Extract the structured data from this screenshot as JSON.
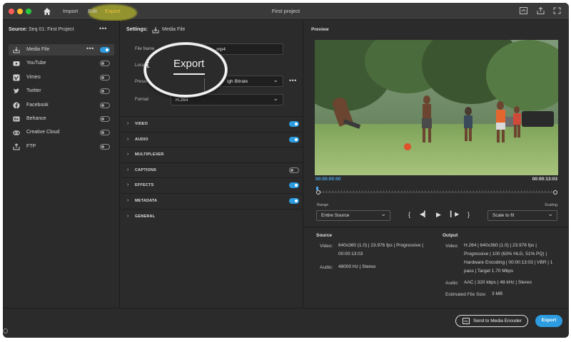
{
  "titlebar": {
    "nav": {
      "import": "Import",
      "edit": "Edit",
      "export": "Export"
    },
    "title": "First project"
  },
  "source": {
    "label": "Source:",
    "value": "Seq 01: First Project",
    "destinations": [
      {
        "label": "Media File",
        "icon": "download-icon",
        "enabled": true
      },
      {
        "label": "YouTube",
        "icon": "youtube-icon",
        "enabled": false
      },
      {
        "label": "Vimeo",
        "icon": "vimeo-icon",
        "enabled": false
      },
      {
        "label": "Twitter",
        "icon": "twitter-icon",
        "enabled": false
      },
      {
        "label": "Facebook",
        "icon": "facebook-icon",
        "enabled": false
      },
      {
        "label": "Behance",
        "icon": "behance-icon",
        "enabled": false
      },
      {
        "label": "Creative Cloud",
        "icon": "creative-cloud-icon",
        "enabled": false
      },
      {
        "label": "FTP",
        "icon": "upload-icon",
        "enabled": false
      }
    ]
  },
  "settings": {
    "label": "Settings:",
    "value": "Media File",
    "file_name_label": "File Name",
    "file_name_value": ".mp4",
    "location_label": "Location",
    "preset_label": "Preset",
    "preset_value": "igh Bitrate",
    "format_label": "Format",
    "format_value": "H.264",
    "sections": [
      {
        "label": "VIDEO",
        "toggle": "on"
      },
      {
        "label": "AUDIO",
        "toggle": "on"
      },
      {
        "label": "MULTIPLEXER",
        "toggle": "none"
      },
      {
        "label": "CAPTIONS",
        "toggle": "off"
      },
      {
        "label": "EFFECTS",
        "toggle": "on"
      },
      {
        "label": "METADATA",
        "toggle": "on"
      },
      {
        "label": "GENERAL",
        "toggle": "none"
      }
    ]
  },
  "magnifier": {
    "left_fragment": "t",
    "label": "Export"
  },
  "preview": {
    "title": "Preview",
    "timecode_start": "00:00:00:00",
    "timecode_end": "00:00:13:03",
    "range_label": "Range",
    "range_value": "Entire Source",
    "scaling_label": "Scaling",
    "scaling_value": "Scale to fit",
    "transport": {
      "in": "{",
      "step_back": "◀▎",
      "play": "▶",
      "step_fwd": "▎▶",
      "out": "}"
    }
  },
  "info": {
    "source": {
      "title": "Source",
      "video_label": "Video:",
      "video_lines": [
        "640x360 (1.0)  |  23.976 fps  |  Progressive  |",
        "00:00:13:03"
      ],
      "audio_label": "Audio:",
      "audio_lines": [
        "48000 Hz  |  Stereo"
      ]
    },
    "output": {
      "title": "Output",
      "video_label": "Video:",
      "video_lines": [
        "H.264  |  640x360 (1.0)  |  23.976 fps  |",
        "Progressive  |  100 (63% HLG, 51% PQ)  |",
        "Hardware Encoding  |  00:00:13:03  |  VBR  |  1",
        "pass  |  Target 1.70 Mbps"
      ],
      "audio_label": "Audio:",
      "audio_lines": [
        "AAC  |  320 kbps  |  48 kHz  |  Stereo"
      ],
      "size_label": "Estimated File Size:",
      "size_value": "3 MB"
    }
  },
  "footer": {
    "send_label": "Send to Media Encoder",
    "send_icon_text": "Me",
    "export_label": "Export"
  },
  "colors": {
    "accent": "#2d9ce0",
    "export_nav": "#f0c23b",
    "timecode": "#4aa6e8"
  }
}
